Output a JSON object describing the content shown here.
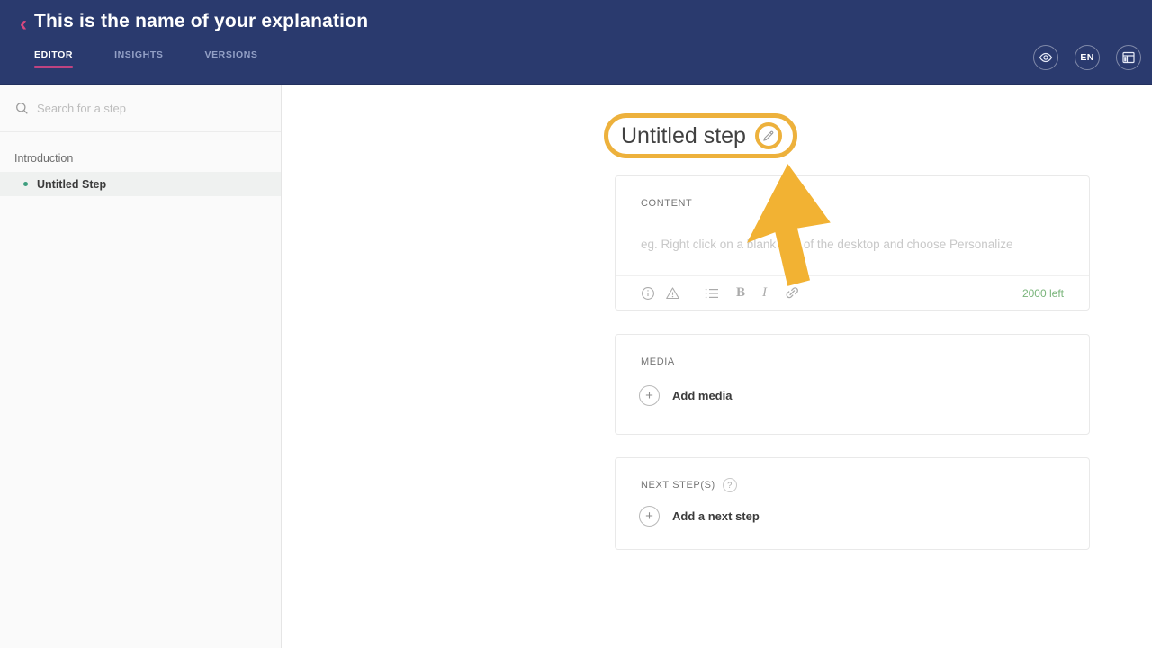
{
  "header": {
    "back_glyph": "‹",
    "title": "This is the name of your explanation",
    "tabs": [
      {
        "label": "EDITOR",
        "active": true
      },
      {
        "label": "INSIGHTS",
        "active": false
      },
      {
        "label": "VERSIONS",
        "active": false
      }
    ],
    "actions": {
      "preview_icon": "eye-icon",
      "language_label": "EN",
      "layout_icon": "layout-icon"
    }
  },
  "sidebar": {
    "search_placeholder": "Search for a step",
    "section_title": "Introduction",
    "steps": [
      {
        "label": "Untitled Step",
        "selected": true
      }
    ]
  },
  "main": {
    "step_title": "Untitled step",
    "content_card": {
      "label": "CONTENT",
      "placeholder": "eg. Right click on a blank part of the desktop and choose Personalize",
      "chars_left": "2000 left",
      "toolbar_icons": [
        "info-icon",
        "warning-icon",
        "list-icon",
        "bold-icon",
        "italic-icon",
        "link-icon"
      ],
      "bold_glyph": "B",
      "italic_glyph": "I"
    },
    "media_card": {
      "label": "MEDIA",
      "add_label": "Add media",
      "plus_glyph": "+"
    },
    "next_card": {
      "label": "NEXT STEP(S)",
      "help_glyph": "?",
      "add_label": "Add a next step",
      "plus_glyph": "+"
    }
  },
  "colors": {
    "header_navy": "#2A3A6E",
    "accent_pink": "#D8487E",
    "tab_underline_pink": "#BE4380",
    "highlight_yellow": "#EDB13C",
    "cursor_yellow": "#F2B233",
    "step_dot_green": "#3E9E7E",
    "chars_left_green": "#79B47A",
    "sidebar_bg": "#FAFAFA",
    "selected_step_bg": "#EFF1F0"
  }
}
